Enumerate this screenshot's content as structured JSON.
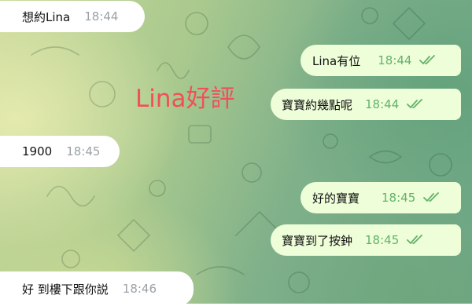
{
  "overlay": {
    "caption": "Lina好評"
  },
  "messages": [
    {
      "direction": "incoming",
      "text": "想約Lina",
      "time": "18:44"
    },
    {
      "direction": "outgoing",
      "text": "Lina有位",
      "time": "18:44",
      "status": "read"
    },
    {
      "direction": "outgoing",
      "text": "寶寶約幾點呢",
      "time": "18:44",
      "status": "read"
    },
    {
      "direction": "incoming",
      "text": "1900",
      "time": "18:45"
    },
    {
      "direction": "outgoing",
      "text": "好的寶寶",
      "time": "18:45",
      "status": "read"
    },
    {
      "direction": "outgoing",
      "text": "寶寶到了按鈡",
      "time": "18:45",
      "status": "read"
    },
    {
      "direction": "incoming",
      "text": "好 到樓下跟你説",
      "time": "18:46"
    }
  ],
  "colors": {
    "incoming_bubble": "#ffffff",
    "outgoing_bubble": "#eefed9",
    "outgoing_time": "#63b26a",
    "incoming_time": "#9aa2a8",
    "caption": "#f0505a"
  },
  "icons": {
    "read_status": "double-check-icon"
  }
}
